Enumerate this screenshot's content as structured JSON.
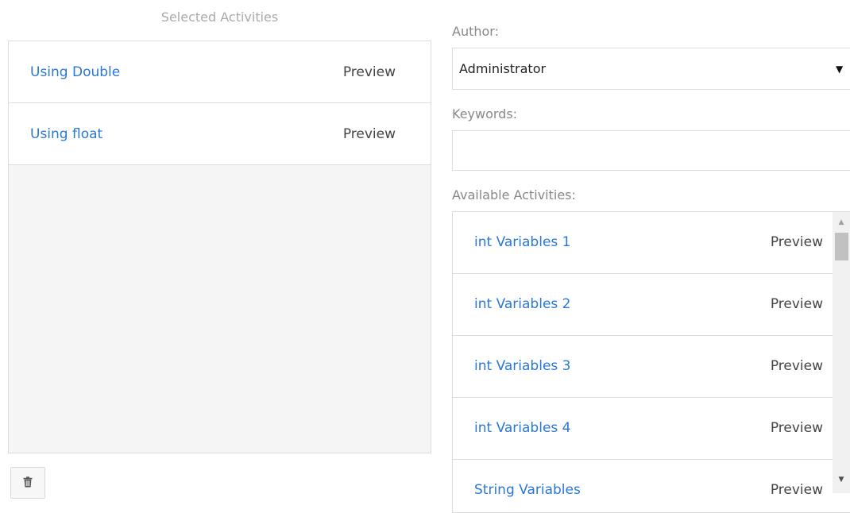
{
  "selected": {
    "title": "Selected Activities",
    "items": [
      {
        "name": "Using Double",
        "preview": "Preview"
      },
      {
        "name": "Using float",
        "preview": "Preview"
      }
    ]
  },
  "filters": {
    "author_label": "Author:",
    "author_value": "Administrator",
    "keywords_label": "Keywords:",
    "keywords_value": ""
  },
  "available": {
    "label": "Available Activities:",
    "items": [
      {
        "name": "int Variables 1",
        "preview": "Preview"
      },
      {
        "name": "int Variables 2",
        "preview": "Preview"
      },
      {
        "name": "int Variables 3",
        "preview": "Preview"
      },
      {
        "name": "int Variables 4",
        "preview": "Preview"
      },
      {
        "name": "String Variables",
        "preview": "Preview"
      }
    ]
  },
  "icons": {
    "trash": "trash-icon",
    "caret": "caret-down-icon"
  },
  "colors": {
    "link": "#2a78d6",
    "border": "#dddddd",
    "panel_bg": "#f5f5f5"
  }
}
